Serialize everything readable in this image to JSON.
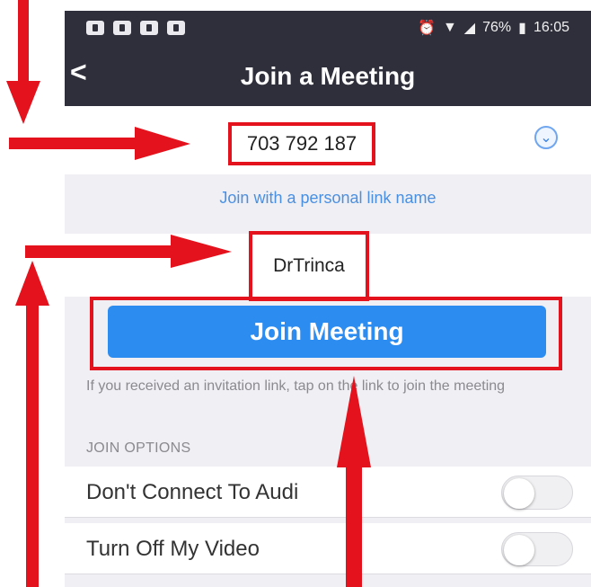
{
  "status_bar": {
    "battery": "76%",
    "time": "16:05",
    "icons": [
      "notification-icon",
      "notification-icon",
      "notification-icon",
      "image-icon",
      "alarm-icon",
      "wifi-icon",
      "signal-icon",
      "battery-icon"
    ]
  },
  "nav": {
    "title": "Join a Meeting",
    "back_label": "<"
  },
  "meeting_id": {
    "value": "703 792 187"
  },
  "personal_link": "Join with a personal link name",
  "display_name": {
    "value": "DrTrinca"
  },
  "join_button": "Join Meeting",
  "info_text": "If you received an invitation link, tap on the link to join the meeting",
  "join_options": {
    "header": "JOIN OPTIONS",
    "items": [
      {
        "label": "Don't Connect To Audi",
        "enabled": false
      },
      {
        "label": "Turn Off My Video",
        "enabled": false
      }
    ]
  },
  "colors": {
    "accent": "#2d8cf0",
    "annotation_red": "#e3121c",
    "navbar": "#2f2f3b",
    "link": "#4a90e2"
  }
}
